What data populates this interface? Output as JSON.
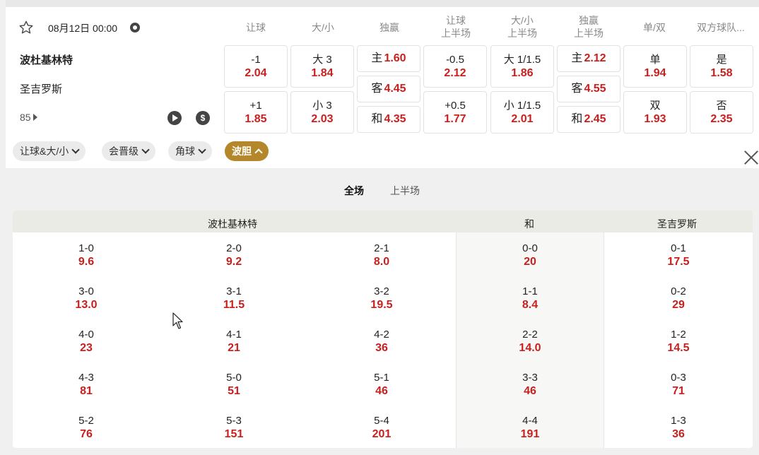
{
  "match": {
    "datetime": "08月12日 00:00",
    "home": "波杜基林特",
    "away": "圣吉罗斯",
    "more_count": "85"
  },
  "columns": [
    "让球",
    "大/小",
    "独赢",
    "让球\n上半场",
    "大/小\n上半场",
    "独赢\n上半场",
    "单/双",
    "双方球队..."
  ],
  "odds": {
    "handicap": [
      {
        "label": "-1",
        "odds": "2.04"
      },
      {
        "label": "+1",
        "odds": "1.85"
      }
    ],
    "over_under": [
      {
        "label": "大 3",
        "odds": "1.84"
      },
      {
        "label": "小 3",
        "odds": "2.03"
      }
    ],
    "moneyline": [
      {
        "label": "主",
        "odds": "1.60"
      },
      {
        "label": "客",
        "odds": "4.45"
      },
      {
        "label": "和",
        "odds": "4.35"
      }
    ],
    "handicap_h1": [
      {
        "label": "-0.5",
        "odds": "2.12"
      },
      {
        "label": "+0.5",
        "odds": "1.77"
      }
    ],
    "over_under_h1": [
      {
        "label": "大 1/1.5",
        "odds": "1.86"
      },
      {
        "label": "小 1/1.5",
        "odds": "2.01"
      }
    ],
    "moneyline_h1": [
      {
        "label": "主",
        "odds": "2.12"
      },
      {
        "label": "客",
        "odds": "4.55"
      },
      {
        "label": "和",
        "odds": "2.45"
      }
    ],
    "odd_even": [
      {
        "label": "单",
        "odds": "1.94"
      },
      {
        "label": "双",
        "odds": "1.93"
      }
    ],
    "btts": [
      {
        "label": "是",
        "odds": "1.58"
      },
      {
        "label": "否",
        "odds": "2.35"
      }
    ]
  },
  "filters": [
    {
      "label": "让球&大/小",
      "active": false
    },
    {
      "label": "会晋级",
      "active": false
    },
    {
      "label": "角球",
      "active": false
    },
    {
      "label": "波胆",
      "active": true
    }
  ],
  "period_tabs": {
    "full": "全场",
    "first_half": "上半场"
  },
  "correct_score": {
    "headers": {
      "home": "波杜基林特",
      "draw": "和",
      "away": "圣吉罗斯"
    },
    "home_cols": [
      [
        {
          "s": "1-0",
          "o": "9.6"
        },
        {
          "s": "3-0",
          "o": "13.0"
        },
        {
          "s": "4-0",
          "o": "23"
        },
        {
          "s": "4-3",
          "o": "81"
        },
        {
          "s": "5-2",
          "o": "76"
        }
      ],
      [
        {
          "s": "2-0",
          "o": "9.2"
        },
        {
          "s": "3-1",
          "o": "11.5"
        },
        {
          "s": "4-1",
          "o": "21"
        },
        {
          "s": "5-0",
          "o": "51"
        },
        {
          "s": "5-3",
          "o": "151"
        }
      ],
      [
        {
          "s": "2-1",
          "o": "8.0"
        },
        {
          "s": "3-2",
          "o": "19.5"
        },
        {
          "s": "4-2",
          "o": "36"
        },
        {
          "s": "5-1",
          "o": "46"
        },
        {
          "s": "5-4",
          "o": "201"
        }
      ]
    ],
    "draw_col": [
      {
        "s": "0-0",
        "o": "20"
      },
      {
        "s": "1-1",
        "o": "8.4"
      },
      {
        "s": "2-2",
        "o": "14.0"
      },
      {
        "s": "3-3",
        "o": "46"
      },
      {
        "s": "4-4",
        "o": "191"
      }
    ],
    "away_col": [
      {
        "s": "0-1",
        "o": "17.5"
      },
      {
        "s": "0-2",
        "o": "29"
      },
      {
        "s": "1-2",
        "o": "14.5"
      },
      {
        "s": "0-3",
        "o": "71"
      },
      {
        "s": "1-3",
        "o": "36"
      }
    ]
  }
}
